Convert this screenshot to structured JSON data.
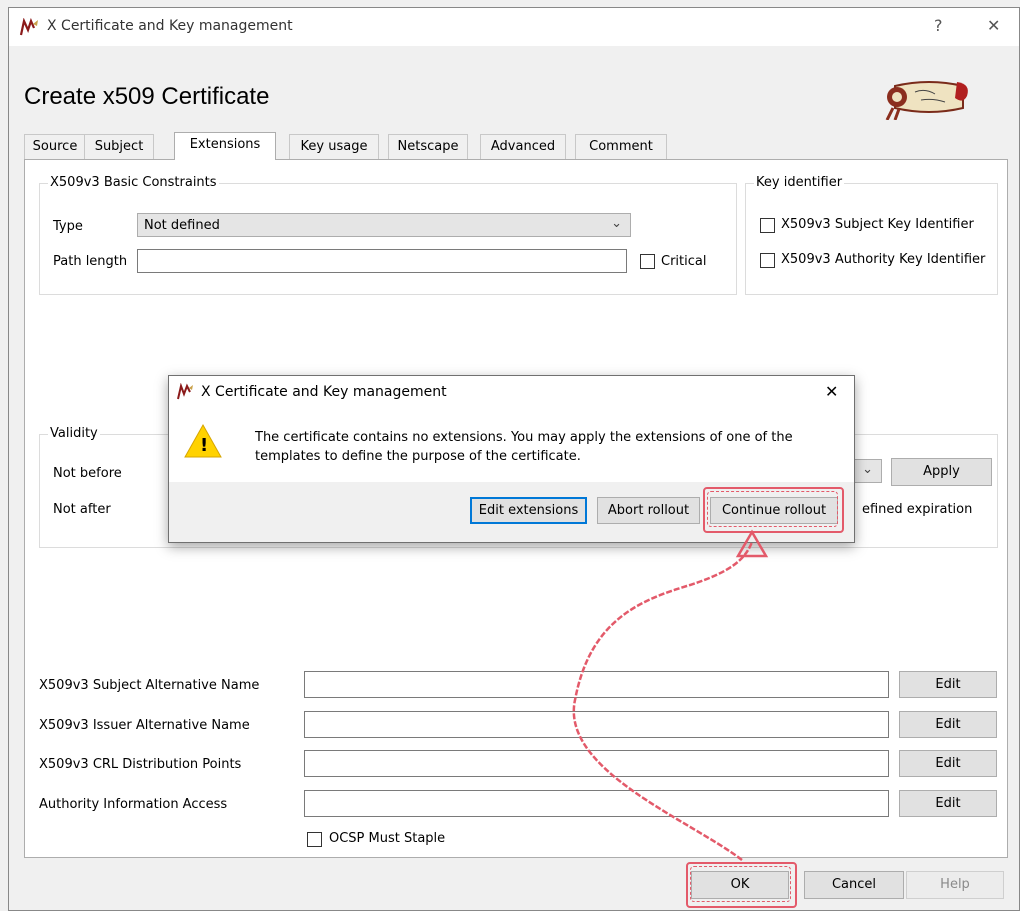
{
  "window": {
    "title": "X Certificate and Key management",
    "help_glyph": "?",
    "close_glyph": "✕"
  },
  "page_title": "Create x509 Certificate",
  "tabs": [
    {
      "label": "Source",
      "active": false
    },
    {
      "label": "Subject",
      "active": false
    },
    {
      "label": "Extensions",
      "active": true
    },
    {
      "label": "Key usage",
      "active": false
    },
    {
      "label": "Netscape",
      "active": false
    },
    {
      "label": "Advanced",
      "active": false
    },
    {
      "label": "Comment",
      "active": false
    }
  ],
  "basic_constraints": {
    "title": "X509v3 Basic Constraints",
    "type_label": "Type",
    "type_value": "Not defined",
    "path_length_label": "Path length",
    "path_length_value": "",
    "critical_label": "Critical"
  },
  "key_identifier": {
    "title": "Key identifier",
    "subject_key_label": "X509v3 Subject Key Identifier",
    "authority_key_label": "X509v3 Authority Key Identifier"
  },
  "validity": {
    "title": "Validity",
    "not_before_label": "Not before",
    "not_after_label": "Not after",
    "apply_label": "Apply",
    "expiration_partial": "efined expiration"
  },
  "alt_names": [
    {
      "label": "X509v3 Subject Alternative Name",
      "value": "",
      "button": "Edit"
    },
    {
      "label": "X509v3 Issuer Alternative Name",
      "value": "",
      "button": "Edit"
    },
    {
      "label": "X509v3 CRL Distribution Points",
      "value": "",
      "button": "Edit"
    },
    {
      "label": "Authority Information Access",
      "value": "",
      "button": "Edit"
    }
  ],
  "ocsp_label": "OCSP Must Staple",
  "footer": {
    "ok_label": "OK",
    "cancel_label": "Cancel",
    "help_label": "Help"
  },
  "modal": {
    "title": "X Certificate and Key management",
    "message": "The certificate contains no extensions. You may apply the extensions of one of the templates to define the purpose of the certificate.",
    "edit_label": "Edit extensions",
    "abort_label": "Abort rollout",
    "continue_label": "Continue rollout",
    "close_glyph": "✕",
    "warning_glyph": "!"
  },
  "colors": {
    "highlight": "#e35a6a",
    "focus_border": "#0078d7",
    "warning_fill": "#ffd200"
  }
}
